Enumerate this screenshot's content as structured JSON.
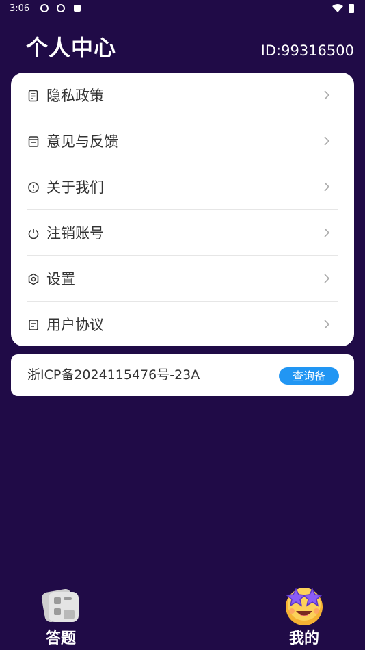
{
  "status_bar": {
    "time": "3:06"
  },
  "header": {
    "title": "个人中心",
    "user_id": "ID:99316500"
  },
  "menu": {
    "items": [
      {
        "label": "隐私政策",
        "icon": "document-icon"
      },
      {
        "label": "意见与反馈",
        "icon": "feedback-icon"
      },
      {
        "label": "关于我们",
        "icon": "info-icon"
      },
      {
        "label": "注销账号",
        "icon": "power-icon"
      },
      {
        "label": "设置",
        "icon": "settings-icon"
      },
      {
        "label": "用户协议",
        "icon": "agreement-icon"
      }
    ]
  },
  "icp": {
    "text": "浙ICP备2024115476号-23A",
    "button_label": "查询备"
  },
  "tabs": [
    {
      "label": "答题",
      "icon": "quiz-icon"
    },
    {
      "label": "我的",
      "icon": "star-face-icon"
    }
  ],
  "colors": {
    "background": "#200b47",
    "accent": "#2196f3",
    "card": "#ffffff"
  }
}
